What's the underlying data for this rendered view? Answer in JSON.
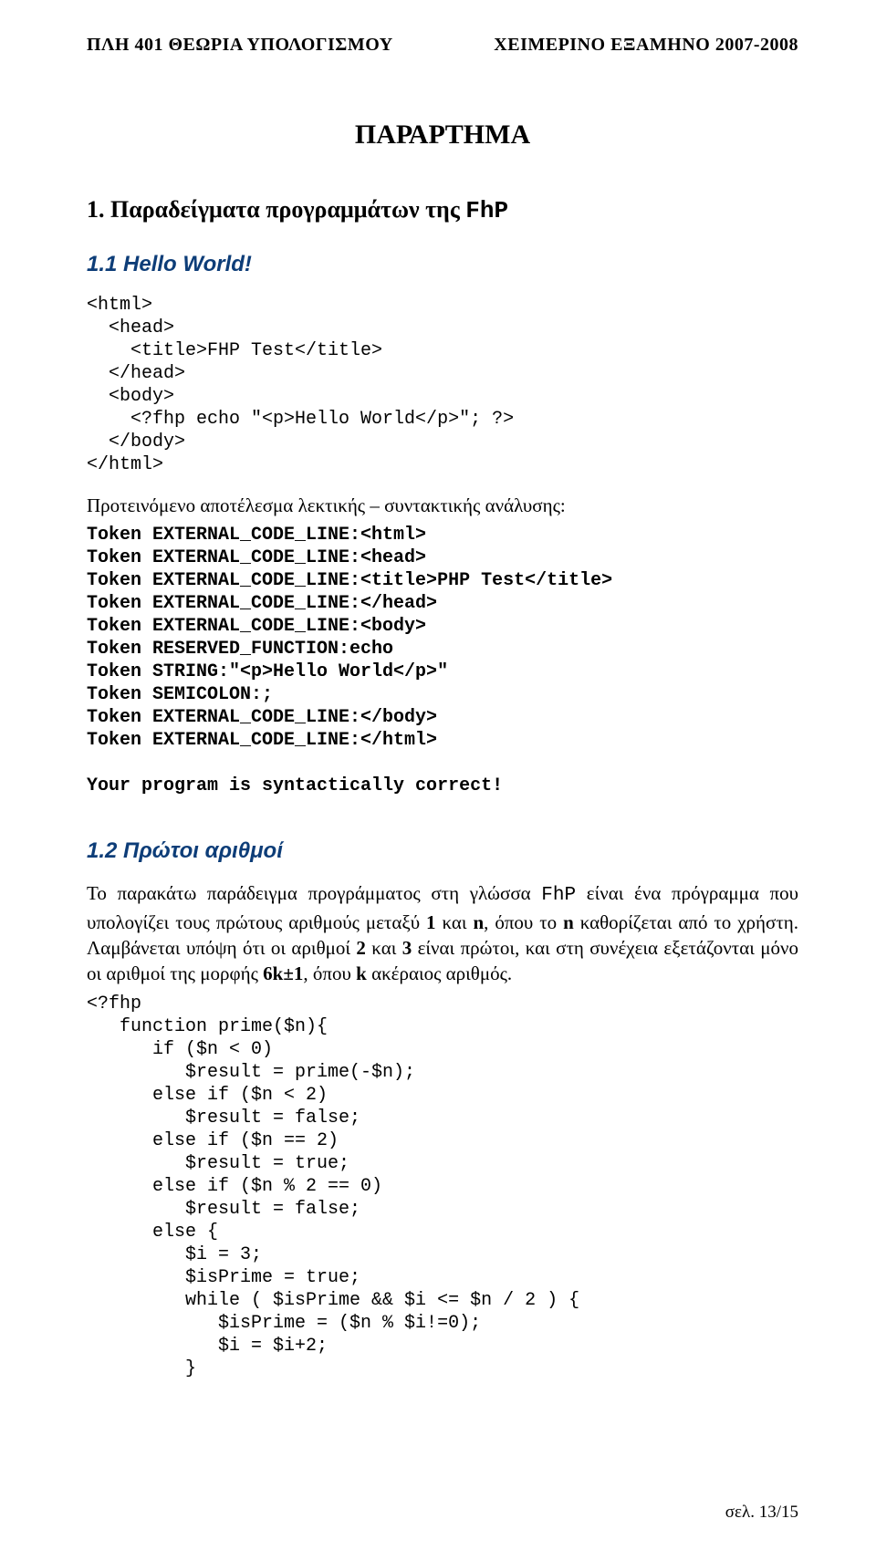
{
  "header": {
    "left": "ΠΛΗ 401 ΘΕΩΡΙΑ ΥΠΟΛΟΓΙΣΜΟΥ",
    "right": "ΧΕΙΜΕΡΙΝΟ ΕΞΑΜΗΝΟ 2007-2008"
  },
  "title": "ΠΑΡΑΡΤΗΜΑ",
  "sec1": {
    "num": "1.",
    "label": "Παραδείγματα προγραμμάτων της ",
    "lang": "FhP"
  },
  "sec11": "1.1 Hello World!",
  "code1": "<html>\n  <head>\n    <title>FHP Test</title>\n  </head>\n  <body>\n    <?fhp echo \"<p>Hello World</p>\"; ?>\n  </body>\n</html>",
  "lexintro": "Προτεινόμενο αποτέλεσμα λεκτικής – συντακτικής ανάλυσης:",
  "tokens": "Token EXTERNAL_CODE_LINE:<html>\nToken EXTERNAL_CODE_LINE:<head>\nToken EXTERNAL_CODE_LINE:<title>PHP Test</title>\nToken EXTERNAL_CODE_LINE:</head>\nToken EXTERNAL_CODE_LINE:<body>\nToken RESERVED_FUNCTION:echo\nToken STRING:\"<p>Hello World</p>\"\nToken SEMICOLON:;\nToken EXTERNAL_CODE_LINE:</body>\nToken EXTERNAL_CODE_LINE:</html>\n\nYour program is syntactically correct!",
  "sec12": "1.2 Πρώτοι αριθμοί",
  "para12_a": "Το παρακάτω παράδειγμα προγράμματος στη γλώσσα ",
  "para12_fhp": "FhP",
  "para12_b1": "  είναι ένα πρόγραμμα που υπολογίζει τους πρώτους αριθμούς μεταξύ ",
  "b1": "1",
  "and": " και ",
  "bn": "n",
  "where": ", όπου το ",
  "bn2": "n",
  "det": " καθορίζεται από το χρήστη. Λαμβάνεται υπόψη ότι οι αριθμοί ",
  "b2": "2",
  "and3": " και ",
  "b3": "3",
  "prime": " είναι πρώτοι, και στη συνέχεια εξετάζονται μόνο οι αριθμοί της μορφής ",
  "formula": "6k±1",
  "wherek": ", όπου ",
  "bk": "k",
  "tail": " ακέραιος αριθμός.",
  "code2": "<?fhp\n   function prime($n){\n      if ($n < 0)\n         $result = prime(-$n);\n      else if ($n < 2)\n         $result = false;\n      else if ($n == 2)\n         $result = true;\n      else if ($n % 2 == 0)\n         $result = false;\n      else {\n         $i = 3;\n         $isPrime = true;\n         while ( $isPrime && $i <= $n / 2 ) {\n            $isPrime = ($n % $i!=0);\n            $i = $i+2;\n         }",
  "footer": "σελ. 13/15"
}
